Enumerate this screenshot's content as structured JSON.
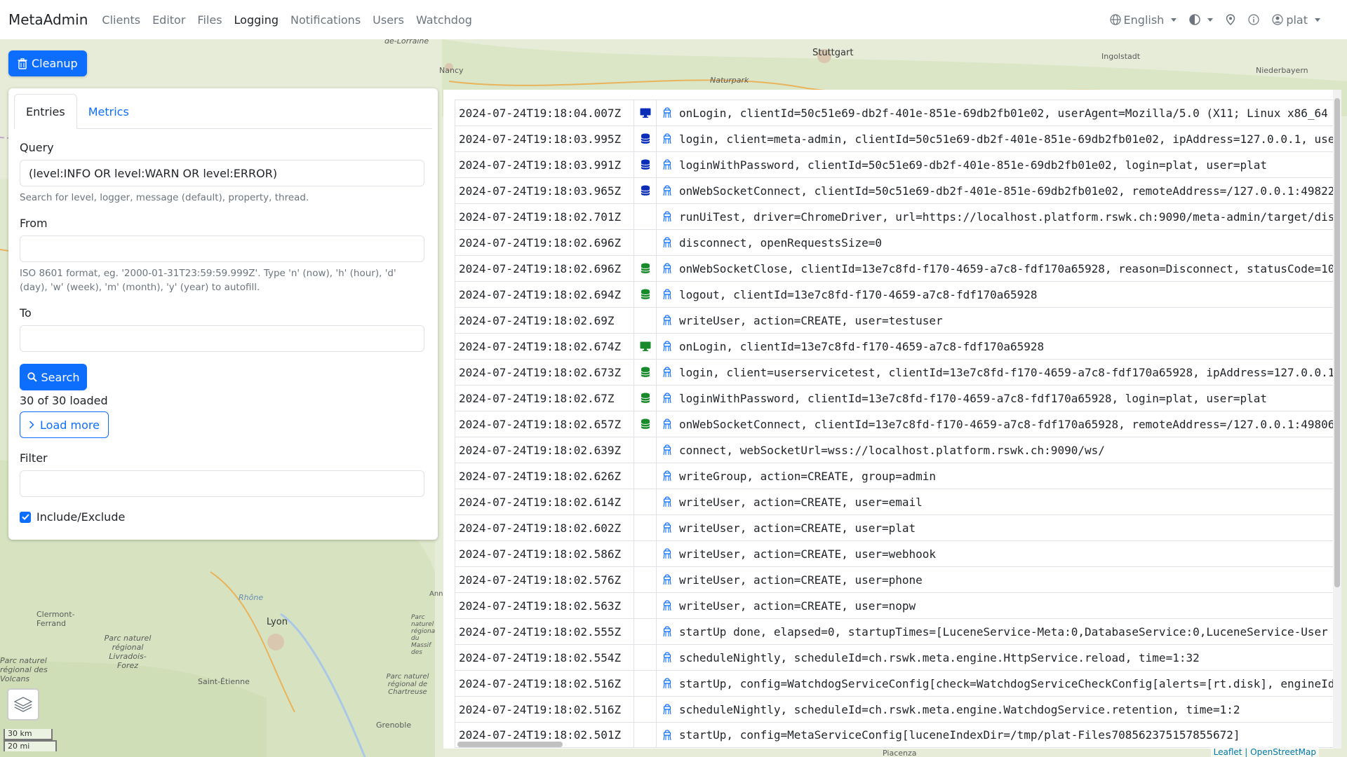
{
  "navbar": {
    "brand": "MetaAdmin",
    "links": [
      "Clients",
      "Editor",
      "Files",
      "Logging",
      "Notifications",
      "Users",
      "Watchdog"
    ],
    "active": "Logging",
    "language": "English",
    "user": "plat"
  },
  "cleanup_label": "Cleanup",
  "tabs": [
    "Entries",
    "Metrics"
  ],
  "form": {
    "query_label": "Query",
    "query_value": "(level:INFO OR level:WARN OR level:ERROR)",
    "query_help": "Search for level, logger, message (default), property, thread.",
    "from_label": "From",
    "from_value": "",
    "from_help": "ISO 8601 format, eg. '2000-01-31T23:59:59.999Z'. Type 'n' (now), 'h' (hour), 'd' (day), 'w' (week), 'm' (month), 'y' (year) to autofill.",
    "to_label": "To",
    "to_value": "",
    "search_label": "Search",
    "loaded_text": "30 of 30 loaded",
    "load_more_label": "Load more",
    "filter_label": "Filter",
    "filter_value": "",
    "include_exclude_label": "Include/Exclude",
    "include_exclude_checked": true
  },
  "colors": {
    "primary": "#0d6efd",
    "level_blue": "#0a2db8",
    "level_green": "#198a2c"
  },
  "map": {
    "labels": [
      "Stuttgart",
      "Nancy",
      "Ingolstadt",
      "Naturpark",
      "Niederbayern",
      "Lyon",
      "Clermont-Ferrand",
      "Saint-Étienne",
      "Grenoble",
      "Parc naturel régional Livradois-Forez",
      "Parc naturel régional des Volcans",
      "Parc naturel régional de Chartreuse",
      "Rhône",
      "Piacenza",
      "de-Lorraine",
      "Parc naturel régional du Massif des Bauges",
      "Anne"
    ],
    "scale_km": "30 km",
    "scale_mi": "20 mi",
    "attribution": "Leaflet | OpenStreetMap"
  },
  "log_entries": [
    {
      "time": "2024-07-24T19:18:04.007Z",
      "level_icon": "monitor-icon",
      "level_color": "blue",
      "message": "onLogin, clientId=50c51e69-db2f-401e-851e-69db2fb01e02, userAgent=Mozilla/5.0 (X11; Linux x86_64"
    },
    {
      "time": "2024-07-24T19:18:03.995Z",
      "level_icon": "database-icon",
      "level_color": "blue",
      "message": "login, client=meta-admin, clientId=50c51e69-db2f-401e-851e-69db2fb01e02, ipAddress=127.0.0.1, use"
    },
    {
      "time": "2024-07-24T19:18:03.991Z",
      "level_icon": "database-icon",
      "level_color": "blue",
      "message": "loginWithPassword, clientId=50c51e69-db2f-401e-851e-69db2fb01e02, login=plat, user=plat"
    },
    {
      "time": "2024-07-24T19:18:03.965Z",
      "level_icon": "database-icon",
      "level_color": "blue",
      "message": "onWebSocketConnect, clientId=50c51e69-db2f-401e-851e-69db2fb01e02, remoteAddress=/127.0.0.1:49822"
    },
    {
      "time": "2024-07-24T19:18:02.701Z",
      "level_icon": "",
      "level_color": "",
      "message": "runUiTest, driver=ChromeDriver, url=https://localhost.platform.rswk.ch:9090/meta-admin/target/dis"
    },
    {
      "time": "2024-07-24T19:18:02.696Z",
      "level_icon": "",
      "level_color": "",
      "message": "disconnect, openRequestsSize=0"
    },
    {
      "time": "2024-07-24T19:18:02.696Z",
      "level_icon": "database-icon",
      "level_color": "green",
      "message": "onWebSocketClose, clientId=13e7c8fd-f170-4659-a7c8-fdf170a65928, reason=Disconnect, statusCode=10"
    },
    {
      "time": "2024-07-24T19:18:02.694Z",
      "level_icon": "database-icon",
      "level_color": "green",
      "message": "logout, clientId=13e7c8fd-f170-4659-a7c8-fdf170a65928"
    },
    {
      "time": "2024-07-24T19:18:02.69Z",
      "level_icon": "",
      "level_color": "",
      "message": "writeUser, action=CREATE, user=testuser"
    },
    {
      "time": "2024-07-24T19:18:02.674Z",
      "level_icon": "monitor-icon",
      "level_color": "green",
      "message": "onLogin, clientId=13e7c8fd-f170-4659-a7c8-fdf170a65928"
    },
    {
      "time": "2024-07-24T19:18:02.673Z",
      "level_icon": "database-icon",
      "level_color": "green",
      "message": "login, client=userservicetest, clientId=13e7c8fd-f170-4659-a7c8-fdf170a65928, ipAddress=127.0.0.1"
    },
    {
      "time": "2024-07-24T19:18:02.67Z",
      "level_icon": "database-icon",
      "level_color": "green",
      "message": "loginWithPassword, clientId=13e7c8fd-f170-4659-a7c8-fdf170a65928, login=plat, user=plat"
    },
    {
      "time": "2024-07-24T19:18:02.657Z",
      "level_icon": "database-icon",
      "level_color": "green",
      "message": "onWebSocketConnect, clientId=13e7c8fd-f170-4659-a7c8-fdf170a65928, remoteAddress=/127.0.0.1:49806"
    },
    {
      "time": "2024-07-24T19:18:02.639Z",
      "level_icon": "",
      "level_color": "",
      "message": "connect, webSocketUrl=wss://localhost.platform.rswk.ch:9090/ws/"
    },
    {
      "time": "2024-07-24T19:18:02.626Z",
      "level_icon": "",
      "level_color": "",
      "message": "writeGroup, action=CREATE, group=admin"
    },
    {
      "time": "2024-07-24T19:18:02.614Z",
      "level_icon": "",
      "level_color": "",
      "message": "writeUser, action=CREATE, user=email"
    },
    {
      "time": "2024-07-24T19:18:02.602Z",
      "level_icon": "",
      "level_color": "",
      "message": "writeUser, action=CREATE, user=plat"
    },
    {
      "time": "2024-07-24T19:18:02.586Z",
      "level_icon": "",
      "level_color": "",
      "message": "writeUser, action=CREATE, user=webhook"
    },
    {
      "time": "2024-07-24T19:18:02.576Z",
      "level_icon": "",
      "level_color": "",
      "message": "writeUser, action=CREATE, user=phone"
    },
    {
      "time": "2024-07-24T19:18:02.563Z",
      "level_icon": "",
      "level_color": "",
      "message": "writeUser, action=CREATE, user=nopw"
    },
    {
      "time": "2024-07-24T19:18:02.555Z",
      "level_icon": "",
      "level_color": "",
      "message": "startUp done, elapsed=0, startupTimes=[LuceneService-Meta:0,DatabaseService:0,LuceneService-User"
    },
    {
      "time": "2024-07-24T19:18:02.554Z",
      "level_icon": "",
      "level_color": "",
      "message": "scheduleNightly, scheduleId=ch.rswk.meta.engine.HttpService.reload, time=1:32"
    },
    {
      "time": "2024-07-24T19:18:02.516Z",
      "level_icon": "",
      "level_color": "",
      "message": "startUp, config=WatchdogServiceConfig[check=WatchdogServiceCheckConfig[alerts=[rt.disk], engineId"
    },
    {
      "time": "2024-07-24T19:18:02.516Z",
      "level_icon": "",
      "level_color": "",
      "message": "scheduleNightly, scheduleId=ch.rswk.meta.engine.WatchdogService.retention, time=1:2"
    },
    {
      "time": "2024-07-24T19:18:02.501Z",
      "level_icon": "",
      "level_color": "",
      "message": "startUp, config=MetaServiceConfig[luceneIndexDir=/tmp/plat-Files708562375157855672]"
    }
  ]
}
